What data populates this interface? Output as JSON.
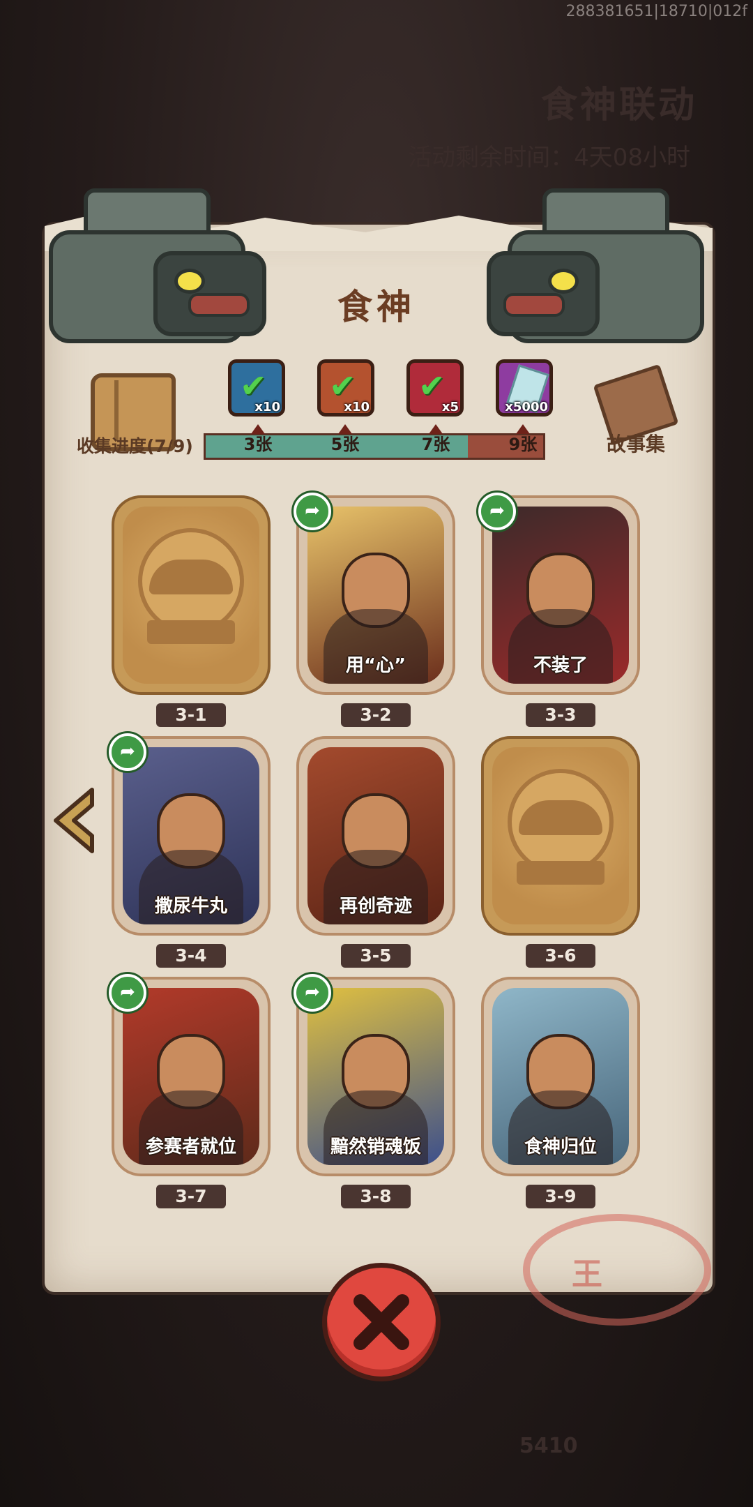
{
  "watermark": "288381651|18710|012f",
  "background": {
    "event_title": "食神联动",
    "event_timer": "活动剩余时间：4天08小时",
    "footer_number": "5410"
  },
  "panel": {
    "title": "食神",
    "progress_label": "收集进度(7/9)",
    "story_label": "故事集",
    "progress": {
      "collected": 7,
      "total": 9
    },
    "milestones": [
      "3张",
      "5张",
      "7张",
      "9张"
    ],
    "rewards": [
      {
        "qty": "x10",
        "claimed": true,
        "icon": "red-ticket-icon",
        "color": "#2e6f9e"
      },
      {
        "qty": "x10",
        "claimed": true,
        "icon": "tool-box-icon",
        "color": "#b4522f"
      },
      {
        "qty": "x5",
        "claimed": true,
        "icon": "rainbow-orb-icon",
        "color": "#b02b3a"
      },
      {
        "qty": "x5000",
        "claimed": false,
        "icon": "crystal-gem-icon",
        "color": "#8e3ca0"
      }
    ],
    "stamp_text": "王"
  },
  "cards": [
    {
      "level": "3-1",
      "caption": "",
      "locked": true,
      "shared": false
    },
    {
      "level": "3-2",
      "caption": "用“心”",
      "locked": false,
      "shared": true
    },
    {
      "level": "3-3",
      "caption": "不装了",
      "locked": false,
      "shared": true
    },
    {
      "level": "3-4",
      "caption": "撒尿牛丸",
      "locked": false,
      "shared": true
    },
    {
      "level": "3-5",
      "caption": "再创奇迹",
      "locked": false,
      "shared": false
    },
    {
      "level": "3-6",
      "caption": "",
      "locked": true,
      "shared": false
    },
    {
      "level": "3-7",
      "caption": "参赛者就位",
      "locked": false,
      "shared": true
    },
    {
      "level": "3-8",
      "caption": "黯然销魂饭",
      "locked": false,
      "shared": true
    },
    {
      "level": "3-9",
      "caption": "食神归位",
      "locked": false,
      "shared": false
    }
  ],
  "buttons": {
    "prev_icon": "chevron-left-icon",
    "close_icon": "close-icon"
  }
}
